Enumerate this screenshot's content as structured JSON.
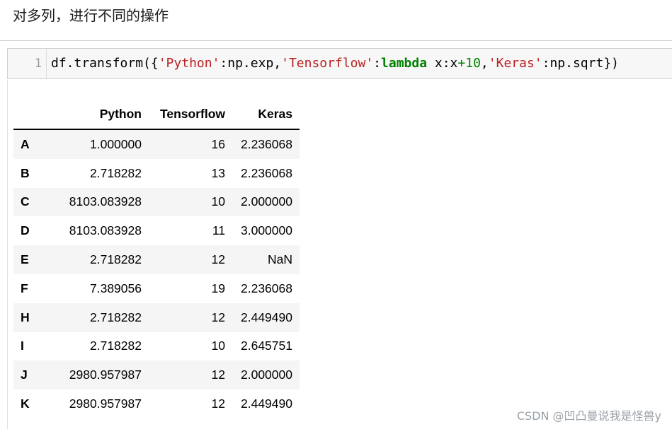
{
  "heading": "对多列，进行不同的操作",
  "cell": {
    "line_number": "1",
    "code_tokens": [
      {
        "t": "df.transform({",
        "c": ""
      },
      {
        "t": "'Python'",
        "c": "str"
      },
      {
        "t": ":np.exp,",
        "c": ""
      },
      {
        "t": "'Tensorflow'",
        "c": "str"
      },
      {
        "t": ":",
        "c": ""
      },
      {
        "t": "lambda",
        "c": "kw"
      },
      {
        "t": " x:x",
        "c": ""
      },
      {
        "t": "+10",
        "c": "num"
      },
      {
        "t": ",",
        "c": ""
      },
      {
        "t": "'Keras'",
        "c": "str"
      },
      {
        "t": ":np.sqrt})",
        "c": ""
      }
    ]
  },
  "table": {
    "columns": [
      "",
      "Python",
      "Tensorflow",
      "Keras"
    ],
    "rows": [
      {
        "index": "A",
        "Python": "1.000000",
        "Tensorflow": "16",
        "Keras": "2.236068"
      },
      {
        "index": "B",
        "Python": "2.718282",
        "Tensorflow": "13",
        "Keras": "2.236068"
      },
      {
        "index": "C",
        "Python": "8103.083928",
        "Tensorflow": "10",
        "Keras": "2.000000"
      },
      {
        "index": "D",
        "Python": "8103.083928",
        "Tensorflow": "11",
        "Keras": "3.000000"
      },
      {
        "index": "E",
        "Python": "2.718282",
        "Tensorflow": "12",
        "Keras": "NaN"
      },
      {
        "index": "F",
        "Python": "7.389056",
        "Tensorflow": "19",
        "Keras": "2.236068"
      },
      {
        "index": "H",
        "Python": "2.718282",
        "Tensorflow": "12",
        "Keras": "2.449490"
      },
      {
        "index": "I",
        "Python": "2.718282",
        "Tensorflow": "10",
        "Keras": "2.645751"
      },
      {
        "index": "J",
        "Python": "2980.957987",
        "Tensorflow": "12",
        "Keras": "2.000000"
      },
      {
        "index": "K",
        "Python": "2980.957987",
        "Tensorflow": "12",
        "Keras": "2.449490"
      }
    ]
  },
  "watermark": "CSDN @凹凸曼说我是怪兽y"
}
